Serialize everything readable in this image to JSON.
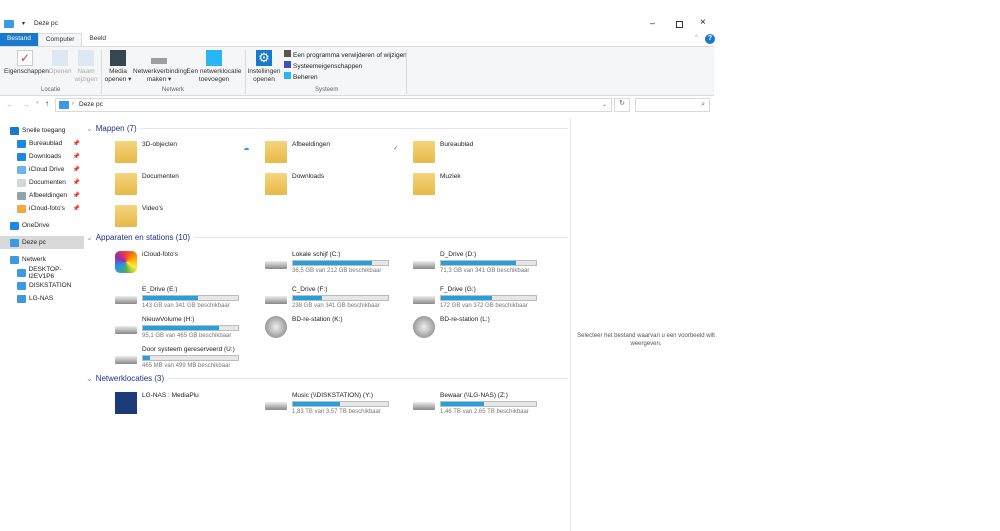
{
  "window": {
    "title": "Deze pc",
    "quick_access_sep": "▾"
  },
  "tabs": [
    {
      "label": "Bestand"
    },
    {
      "label": "Computer"
    },
    {
      "label": "Beeld"
    }
  ],
  "ribbon": {
    "locatie": {
      "label": "Locatie",
      "buttons": [
        {
          "label": "Eigenschappen"
        },
        {
          "label": "Openen"
        },
        {
          "label": "Naam wijzigen"
        }
      ]
    },
    "netwerk": {
      "label": "Netwerk",
      "buttons": [
        {
          "label": "Media openen ▾"
        },
        {
          "label": "Netwerkverbinding maken ▾"
        },
        {
          "label": "Een netwerklocatie toevoegen"
        }
      ]
    },
    "systeem": {
      "label": "Systeem",
      "settings": "Instellingen openen",
      "small": [
        {
          "label": "Een programma verwijderen of wijzigen"
        },
        {
          "label": "Systeemeigenschappen"
        },
        {
          "label": "Beheren"
        }
      ]
    }
  },
  "address": {
    "path": "Deze pc",
    "search_placeholder": ""
  },
  "nav": [
    {
      "label": "Snelle toegang",
      "color": "#1979ca",
      "top": true
    },
    {
      "label": "Bureaublad",
      "color": "#1e88e5",
      "pin": true
    },
    {
      "label": "Downloads",
      "color": "#1e88e5",
      "pin": true
    },
    {
      "label": "iCloud Drive",
      "color": "#6fb3e8",
      "pin": true
    },
    {
      "label": "Documenten",
      "color": "#cfd8dc",
      "pin": true
    },
    {
      "label": "Afbeeldingen",
      "color": "#90a4ae",
      "pin": true
    },
    {
      "label": "iCloud-foto's",
      "color": "#f4a742",
      "pin": true
    },
    {
      "label": "OneDrive",
      "color": "#1e88e5",
      "top": true
    },
    {
      "label": "Deze pc",
      "color": "#3b9ae1",
      "top": true,
      "selected": true
    },
    {
      "label": "Netwerk",
      "color": "#3b9ae1",
      "top": true
    },
    {
      "label": "DESKTOP-I2EV1P6",
      "color": "#3b9ae1"
    },
    {
      "label": "DISKSTATION",
      "color": "#3b9ae1"
    },
    {
      "label": "LG-NAS",
      "color": "#3b9ae1"
    }
  ],
  "sections": {
    "folders": "Mappen (7)",
    "devices": "Apparaten en stations (10)",
    "network": "Netwerklocaties (3)"
  },
  "folders": [
    {
      "label": "3D-objecten",
      "status": "cloud"
    },
    {
      "label": "Afbeeldingen",
      "status": "synced"
    },
    {
      "label": "Bureaublad"
    },
    {
      "label": "Documenten"
    },
    {
      "label": "Downloads"
    },
    {
      "label": "Muziek"
    },
    {
      "label": "Video's"
    }
  ],
  "devices": [
    {
      "label": "iCloud-foto's"
    },
    {
      "label": "Lokale schijf (C:)",
      "info": "36,5 GB van 212 GB beschikbaar",
      "used_pct": 83
    },
    {
      "label": "D_Drive (D:)",
      "info": "71,3 GB van 341 GB beschikbaar",
      "used_pct": 79
    },
    {
      "label": "E_Drive (E:)",
      "info": "143 GB van 341 GB beschikbaar",
      "used_pct": 58
    },
    {
      "label": "C_Drive (F:)",
      "info": "238 GB van 341 GB beschikbaar",
      "used_pct": 30
    },
    {
      "label": "F_Drive (G:)",
      "info": "172 GB van 372 GB beschikbaar",
      "used_pct": 54
    },
    {
      "label": "NieuwVolume (H:)",
      "info": "95,1 GB van 465 GB beschikbaar",
      "used_pct": 80
    },
    {
      "label": "BD-re-station (K:)"
    },
    {
      "label": "BD-re-station (L:)"
    },
    {
      "label": "Door systeem gereserveerd (U:)",
      "info": "465 MB van 499 MB beschikbaar",
      "used_pct": 7
    }
  ],
  "network": [
    {
      "label": "LG-NAS : MediaPlu"
    },
    {
      "label": "Music (\\\\DISKSTATION) (Y:)",
      "info": "1,83 TB van 3,57 TB beschikbaar",
      "used_pct": 49
    },
    {
      "label": "Bewaar (\\\\LG-NAS) (Z:)",
      "info": "1,46 TB van 2,65 TB beschikbaar",
      "used_pct": 45
    }
  ],
  "preview": {
    "text": "Selecteer het bestand waarvan u een voorbeeld wilt weergeven."
  },
  "accent": "#1979ca",
  "bar_color": "#26a0da"
}
